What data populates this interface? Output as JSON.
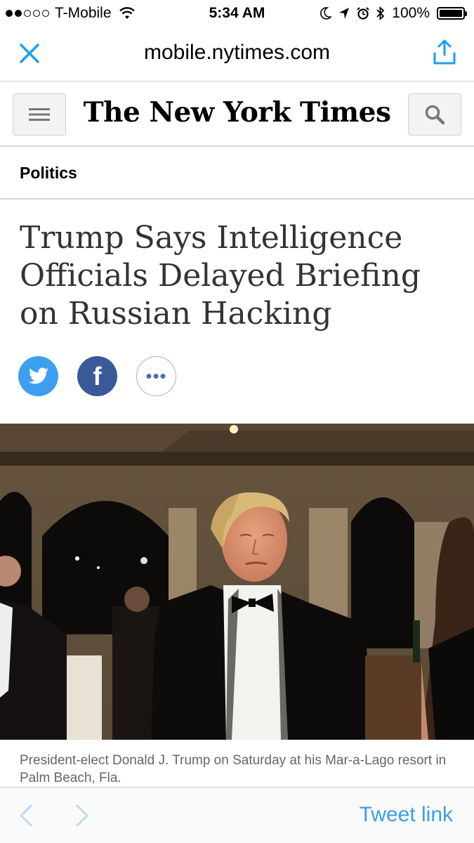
{
  "status_bar": {
    "carrier": "T-Mobile",
    "time": "5:34 AM",
    "battery": "100%",
    "signal_bars_filled": 2,
    "signal_bars_total": 5
  },
  "browser": {
    "url": "mobile.nytimes.com"
  },
  "header": {
    "logo": "The New York Times"
  },
  "article": {
    "section": "Politics",
    "headline": "Trump Says Intelligence Officials Delayed Briefing on Russian Hacking",
    "share": {
      "facebook_glyph": "f",
      "more_glyph": "•••"
    },
    "caption": "President-elect Donald J. Trump on Saturday at his Mar-a-Lago resort in Palm Beach, Fla."
  },
  "toolbar": {
    "tweet_link": "Tweet link"
  },
  "colors": {
    "accent_blue": "#1a9ff0",
    "twitter": "#3d9ff0",
    "facebook": "#3b5998",
    "link": "#3a9fea"
  }
}
